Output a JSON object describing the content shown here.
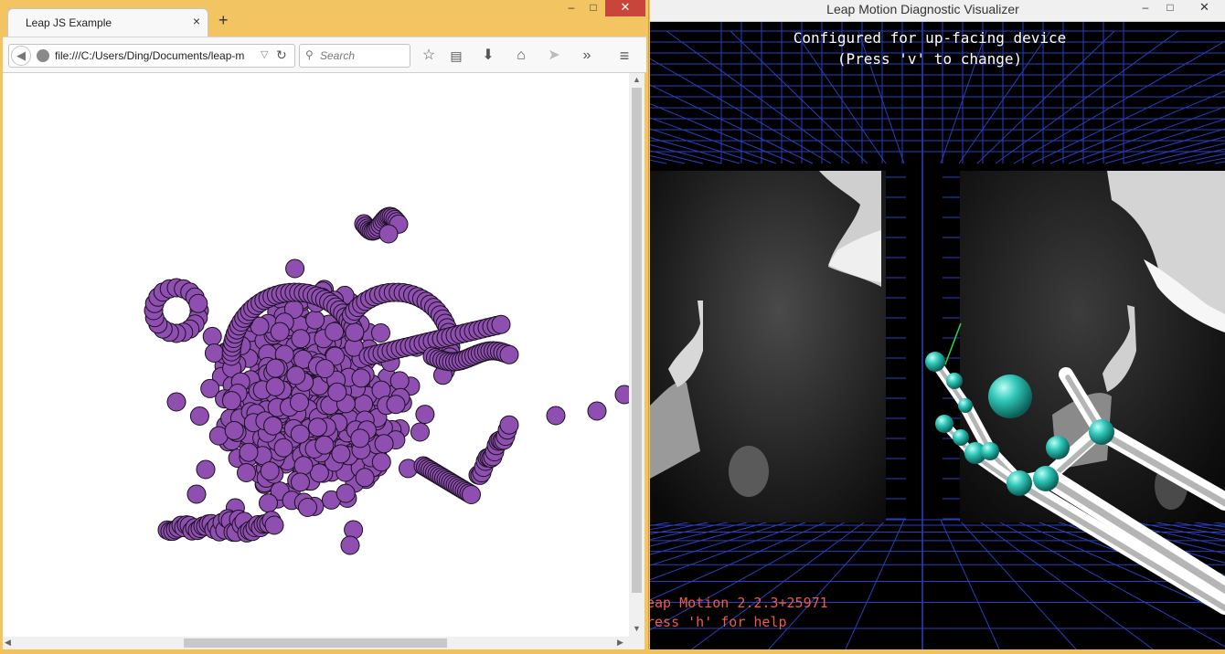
{
  "browser": {
    "tab_title": "Leap JS Example",
    "tab_close_icon": "×",
    "new_tab_icon": "+",
    "url": "file:///C:/Users/Ding/Documents/leap-m",
    "search_placeholder": "Search",
    "window_controls": {
      "minimize": "–",
      "maximize": "□",
      "close": "✕"
    },
    "toolbar_icons": [
      "bookmark-star-icon",
      "reading-list-icon",
      "download-icon",
      "home-icon",
      "send-icon",
      "overflow-chevron-icon",
      "menu-icon"
    ],
    "point_color": "#8e4fb0",
    "point_stroke": "#1a0f20"
  },
  "visualizer": {
    "window_title": "Leap Motion Diagnostic Visualizer",
    "config_line1": "Configured for up-facing device",
    "config_line2": "(Press 'v' to change)",
    "version_text": "eap Motion 2.2.3+25971",
    "help_text": "ress 'h' for help",
    "grid_color": "#2a3fbf",
    "joint_color": "#2ec4b6",
    "bone_color": "#f0f0f0",
    "text_color_status": "#f05a4a"
  }
}
